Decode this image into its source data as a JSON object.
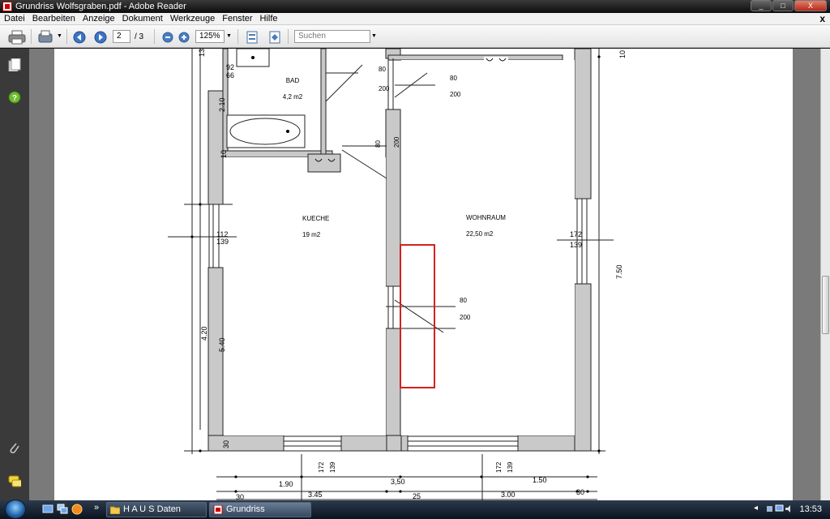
{
  "window": {
    "title": "Grundriss Wolfsgraben.pdf - Adobe Reader",
    "minimize": "_",
    "maximize": "□",
    "close": "X"
  },
  "menu": {
    "items": [
      "Datei",
      "Bearbeiten",
      "Anzeige",
      "Dokument",
      "Werkzeuge",
      "Fenster",
      "Hilfe"
    ],
    "close_doc": "x"
  },
  "toolbar": {
    "page_current": "2",
    "page_total": "/ 3",
    "zoom": "125%",
    "search_placeholder": "Suchen"
  },
  "plan": {
    "rooms": {
      "bad": {
        "name": "BAD",
        "area": "4,2 m2"
      },
      "kueche": {
        "name": "KUECHE",
        "area": "19 m2"
      },
      "wohnraum": {
        "name": "WOHNRAUM",
        "area": "22,50 m2"
      }
    },
    "dims": {
      "top_13": "13",
      "top_10": "10",
      "d92": "92",
      "d66": "66",
      "d210": "2.10",
      "d10": "10",
      "d112": "112",
      "d139a": "139",
      "d420": "4.20",
      "d540": "5.40",
      "d30a": "30",
      "door_bad_80": "80",
      "door_bad_200": "200",
      "door_wohn_80": "80",
      "door_wohn_200": "200",
      "door_k_80": "80",
      "door_k_200": "200",
      "door_mid_80": "80",
      "door_mid_200": "200",
      "right_172": "172",
      "right_139": "139",
      "right_750": "7.50",
      "b_172a": "172",
      "b_139a": "139",
      "b_172b": "172",
      "b_139b": "139",
      "b_190": "1.90",
      "b_350": "3,50",
      "b_150": "1.50",
      "b_30a": "30",
      "b_345": "3.45",
      "b_25": "25",
      "b_300": "3.00",
      "b_30b": "30"
    }
  },
  "taskbar": {
    "tasks": [
      "H A U S  Daten",
      "Grundriss Wolfsgrab..."
    ],
    "clock": "13:53",
    "chevron": "»"
  },
  "colors": {
    "wall": "#c9c9c9",
    "highlight": "#d42020"
  }
}
